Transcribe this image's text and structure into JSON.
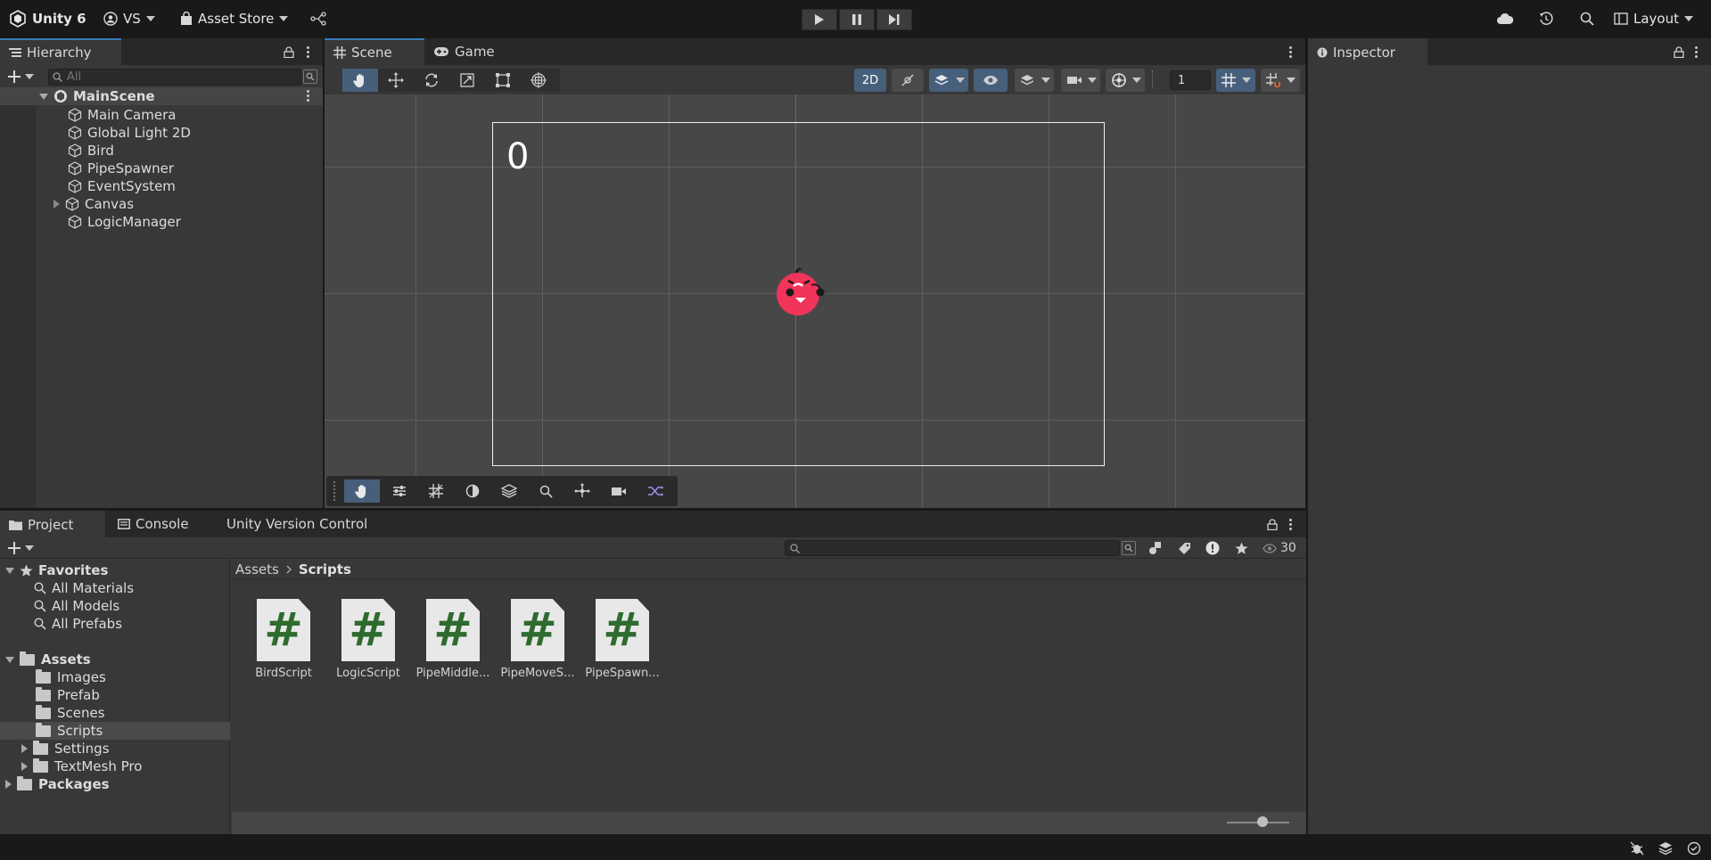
{
  "app": {
    "title": "Unity 6"
  },
  "topbar": {
    "account": "VS",
    "asset_store": "Asset Store",
    "layout": "Layout"
  },
  "hierarchy": {
    "tab": "Hierarchy",
    "search_placeholder": "All",
    "scene": "MainScene",
    "items": [
      "Main Camera",
      "Global Light 2D",
      "Bird",
      "PipeSpawner",
      "EventSystem",
      "Canvas",
      "LogicManager"
    ]
  },
  "scene_view": {
    "tabs": [
      "Scene",
      "Game"
    ],
    "mode_2d": "2D",
    "grid_value": "1",
    "score_text": "0"
  },
  "inspector": {
    "tab": "Inspector"
  },
  "project": {
    "tabs": [
      "Project",
      "Console",
      "Unity Version Control"
    ],
    "visible_count": "30",
    "breadcrumb": [
      "Assets",
      "Scripts"
    ],
    "favorites": {
      "label": "Favorites",
      "items": [
        "All Materials",
        "All Models",
        "All Prefabs"
      ]
    },
    "assets": {
      "label": "Assets",
      "items": [
        "Images",
        "Prefab",
        "Scenes",
        "Scripts",
        "Settings",
        "TextMesh Pro"
      ]
    },
    "packages": "Packages",
    "files": [
      "BirdScript",
      "LogicScript",
      "PipeMiddle...",
      "PipeMoveS...",
      "PipeSpawn..."
    ]
  },
  "colors": {
    "accent": "#3a79bb",
    "bird": "#f0345a",
    "script_icon": "#2e6b2e"
  }
}
